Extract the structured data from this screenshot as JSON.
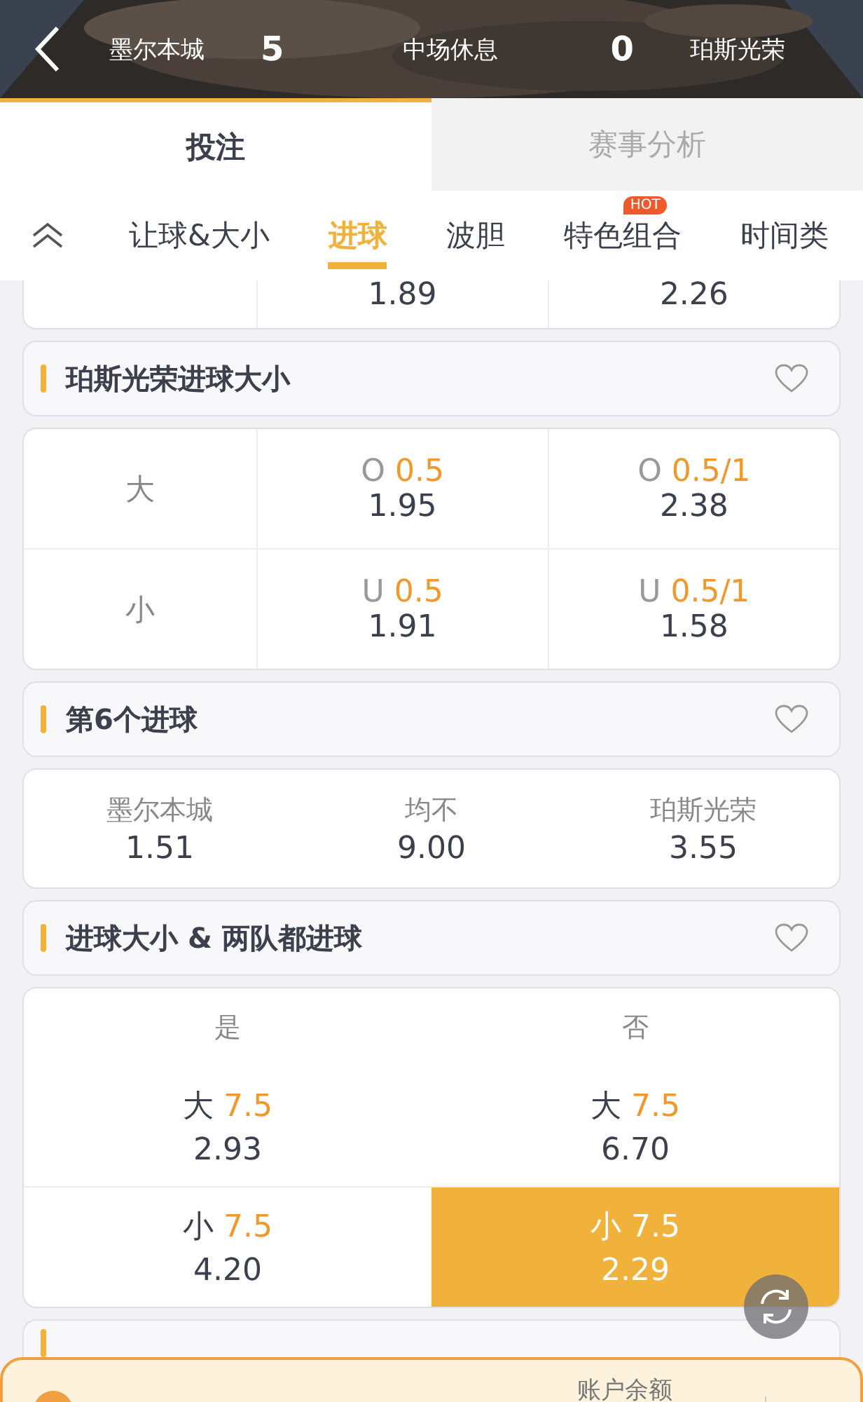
{
  "header": {
    "home_team": "墨尔本城",
    "home_score": "5",
    "status": "中场休息",
    "away_score": "0",
    "away_team": "珀斯光荣"
  },
  "main_tabs": [
    {
      "label": "投注",
      "selected": true
    },
    {
      "label": "赛事分析",
      "selected": false
    }
  ],
  "market_tabs": [
    {
      "label": "让球&大小",
      "selected": false
    },
    {
      "label": "进球",
      "selected": true
    },
    {
      "label": "波胆",
      "selected": false
    },
    {
      "label": "特色组合",
      "selected": false,
      "badge": "HOT"
    },
    {
      "label": "时间类",
      "selected": false
    }
  ],
  "sections": [
    {
      "kind": "odds_tail",
      "odds": [
        "1.89",
        "2.26"
      ]
    },
    {
      "kind": "line_grid",
      "title": "珀斯光荣进球大小",
      "favorite": false,
      "rows": [
        {
          "label": "大",
          "cells": [
            {
              "prefix": "O",
              "line": "0.5",
              "odds": "1.95"
            },
            {
              "prefix": "O",
              "line": "0.5/1",
              "odds": "2.38"
            }
          ]
        },
        {
          "label": "小",
          "cells": [
            {
              "prefix": "U",
              "line": "0.5",
              "odds": "1.91"
            },
            {
              "prefix": "U",
              "line": "0.5/1",
              "odds": "1.58"
            }
          ]
        }
      ]
    },
    {
      "kind": "three_way",
      "title": "第6个进球",
      "favorite": false,
      "outcomes": [
        {
          "name": "墨尔本城",
          "odds": "1.51"
        },
        {
          "name": "均不",
          "odds": "9.00"
        },
        {
          "name": "珀斯光荣",
          "odds": "3.55"
        }
      ]
    },
    {
      "kind": "combo",
      "title": "进球大小 & 两队都进球",
      "favorite": false,
      "columns": [
        "是",
        "否"
      ],
      "rows": [
        [
          {
            "label": "大",
            "line": "7.5",
            "odds": "2.93",
            "selected": false
          },
          {
            "label": "大",
            "line": "7.5",
            "odds": "6.70",
            "selected": false
          }
        ],
        [
          {
            "label": "小",
            "line": "7.5",
            "odds": "4.20",
            "selected": false
          },
          {
            "label": "小",
            "line": "7.5",
            "odds": "2.29",
            "selected": true
          }
        ]
      ]
    },
    {
      "kind": "header_cut"
    }
  ],
  "bet_slip": {
    "balance_label": "账户余额"
  }
}
